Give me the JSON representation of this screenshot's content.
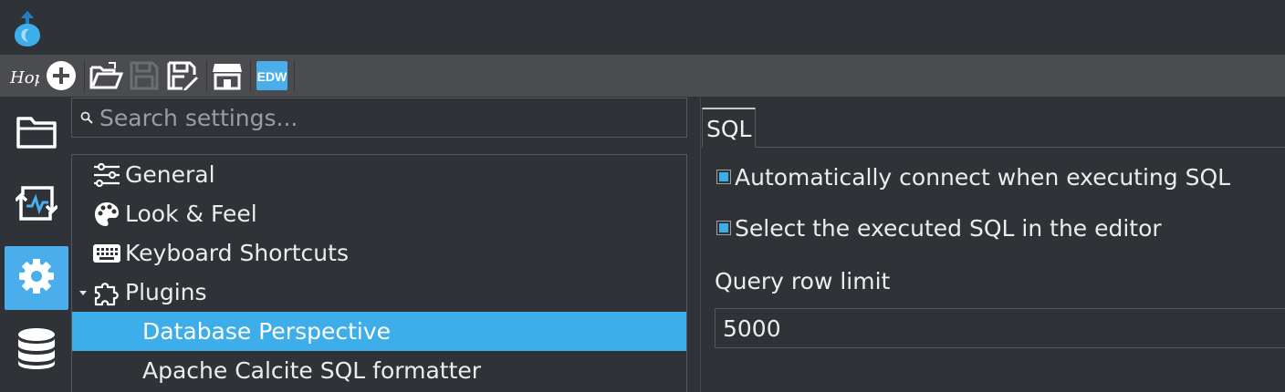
{
  "app": {
    "logo_icon": "hop-logo-drop-icon"
  },
  "toolbar": {
    "buttons": [
      {
        "name": "hop-logo-button",
        "icon": "hop-text-icon"
      },
      {
        "name": "new-button",
        "icon": "plus-circle-icon"
      },
      {
        "name": "open-button",
        "icon": "folder-open-icon"
      },
      {
        "name": "save-button",
        "icon": "floppy-disk-icon"
      },
      {
        "name": "save-as-button",
        "icon": "floppy-disk-pen-icon"
      },
      {
        "name": "marketplace-button",
        "icon": "storefront-icon"
      },
      {
        "name": "edw-button",
        "icon": "edw-icon",
        "label": "EDW"
      }
    ]
  },
  "sidenav": {
    "items": [
      {
        "name": "explorer",
        "icon": "folder-icon",
        "active": false
      },
      {
        "name": "execution",
        "icon": "execution-loop-icon",
        "active": false
      },
      {
        "name": "configuration",
        "icon": "gear-icon",
        "active": true
      },
      {
        "name": "database",
        "icon": "database-icon",
        "active": false
      }
    ]
  },
  "settings": {
    "search_placeholder": "Search settings...",
    "tree": [
      {
        "label": "General",
        "icon": "sliders-icon",
        "level": 0
      },
      {
        "label": "Look & Feel",
        "icon": "palette-icon",
        "level": 0
      },
      {
        "label": "Keyboard Shortcuts",
        "icon": "keyboard-icon",
        "level": 0
      },
      {
        "label": "Plugins",
        "icon": "puzzle-icon",
        "level": 0,
        "expanded": true
      },
      {
        "label": "Database Perspective",
        "level": 1,
        "selected": true
      },
      {
        "label": "Apache Calcite SQL formatter",
        "level": 1
      }
    ]
  },
  "detail": {
    "tab_label": "SQL",
    "auto_connect_label": "Automatically connect when executing SQL",
    "auto_connect_checked": true,
    "select_executed_label": "Select the executed SQL in the editor",
    "select_executed_checked": true,
    "query_row_limit_label": "Query row limit",
    "query_row_limit_value": "5000"
  },
  "colors": {
    "accent": "#3daee9",
    "toolbar_bg": "#4a4c4f",
    "window_bg": "#2f3236"
  }
}
